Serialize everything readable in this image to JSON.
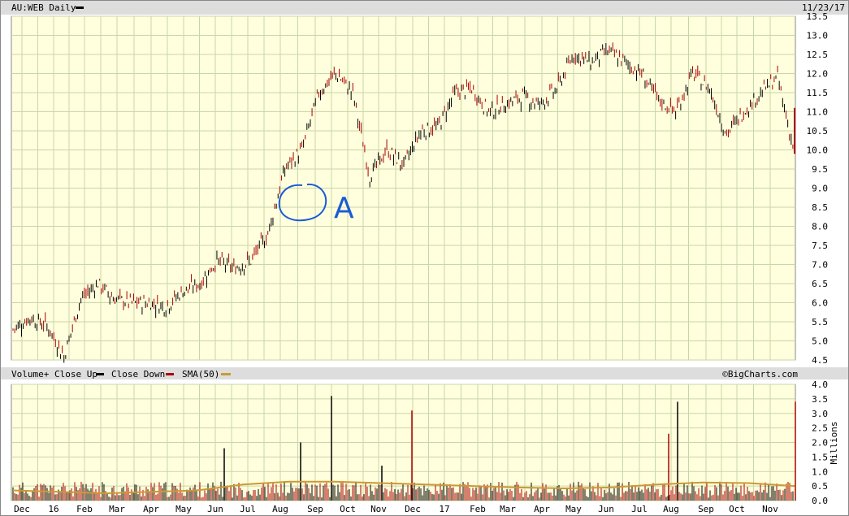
{
  "header": {
    "symbol": "AU:WEB",
    "period": "Daily",
    "date": "11/23/17"
  },
  "volume_header": {
    "title": "Volume+",
    "close_up": "Close Up",
    "close_down": "Close Down",
    "sma_label": "SMA(50)",
    "credit": "©BigCharts.com"
  },
  "colors": {
    "background": "#ffffdd",
    "grid": "#c8d6a8",
    "up": "#000000",
    "down": "#aa0000",
    "sma": "#cc9933",
    "annotation": "#1a5bd6",
    "header_bg": "#dddddd"
  },
  "annotation": {
    "text": "A"
  },
  "chart_data": [
    {
      "type": "line",
      "title": "AU:WEB Daily",
      "ylim": [
        4.5,
        13.5
      ],
      "y_ticks": [
        "4.5",
        "5.0",
        "5.5",
        "6.0",
        "6.5",
        "7.0",
        "7.5",
        "8.0",
        "8.5",
        "9.0",
        "9.5",
        "10.0",
        "10.5",
        "11.0",
        "11.5",
        "12.0",
        "12.5",
        "13.0",
        "13.5"
      ],
      "x_ticks": [
        "Dec",
        "16",
        "Feb",
        "Mar",
        "Apr",
        "May",
        "Jun",
        "Jul",
        "Aug",
        "Sep",
        "Oct",
        "Nov",
        "Dec",
        "17",
        "Feb",
        "Mar",
        "Apr",
        "May",
        "Jun",
        "Jul",
        "Aug",
        "Sep",
        "Oct",
        "Nov"
      ],
      "series": [
        {
          "points": [
            [
              "Dec",
              5.3
            ],
            [
              "16",
              5.6
            ],
            [
              "Feb",
              5.4
            ],
            [
              "Feb",
              4.6
            ],
            [
              "Mar",
              6.1
            ],
            [
              "Mar",
              6.5
            ],
            [
              "Apr",
              6.1
            ],
            [
              "Apr",
              6.0
            ],
            [
              "May",
              6.0
            ],
            [
              "May",
              5.9
            ],
            [
              "Jun",
              6.3
            ],
            [
              "Jun",
              6.5
            ],
            [
              "Jul",
              7.1
            ],
            [
              "Jul",
              6.9
            ],
            [
              "Aug",
              7.1
            ],
            [
              "Aug",
              7.8
            ],
            [
              "Sep",
              9.5
            ],
            [
              "Sep",
              10.0
            ],
            [
              "Oct",
              11.5
            ],
            [
              "Oct",
              12.0
            ],
            [
              "Nov",
              11.5
            ],
            [
              "Nov",
              9.3
            ],
            [
              "Dec",
              10.0
            ],
            [
              "Dec",
              9.6
            ],
            [
              "17",
              10.5
            ],
            [
              "17",
              10.6
            ],
            [
              "Feb",
              11.5
            ],
            [
              "Feb",
              11.6
            ],
            [
              "Mar",
              11.0
            ],
            [
              "Mar",
              11.2
            ],
            [
              "Apr",
              11.4
            ],
            [
              "Apr",
              11.2
            ],
            [
              "May",
              11.6
            ],
            [
              "May",
              12.5
            ],
            [
              "Jun",
              12.3
            ],
            [
              "Jun",
              12.6
            ],
            [
              "Jul",
              12.3
            ],
            [
              "Jul",
              12.0
            ],
            [
              "Aug",
              11.3
            ],
            [
              "Aug",
              11.0
            ],
            [
              "Sep",
              12.0
            ],
            [
              "Sep",
              11.6
            ],
            [
              "Oct",
              10.4
            ],
            [
              "Oct",
              11.0
            ],
            [
              "Nov",
              11.5
            ],
            [
              "Nov",
              11.9
            ],
            [
              "Nov",
              9.9
            ]
          ]
        }
      ]
    },
    {
      "type": "bar",
      "title": "Volume+",
      "ylabel": "Millions",
      "ylim": [
        0,
        4.0
      ],
      "y_ticks": [
        "0.0",
        "0.5",
        "1.0",
        "1.5",
        "2.0",
        "2.5",
        "3.0",
        "3.5",
        "4.0"
      ],
      "spikes": [
        [
          "Jun",
          1.8
        ],
        [
          "Aug",
          2.0
        ],
        [
          "Sep",
          3.6
        ],
        [
          "Nov",
          1.2
        ],
        [
          "Dec",
          3.1
        ],
        [
          "Aug",
          3.4
        ],
        [
          "Aug",
          2.3
        ],
        [
          "Nov",
          3.4
        ]
      ],
      "series": [
        {
          "name": "SMA(50)",
          "values": [
            0.35,
            0.3,
            0.25,
            0.3,
            0.35,
            0.55,
            0.65,
            0.65,
            0.6,
            0.55,
            0.5,
            0.45,
            0.42,
            0.45,
            0.55,
            0.62,
            0.6,
            0.5
          ]
        }
      ]
    }
  ]
}
